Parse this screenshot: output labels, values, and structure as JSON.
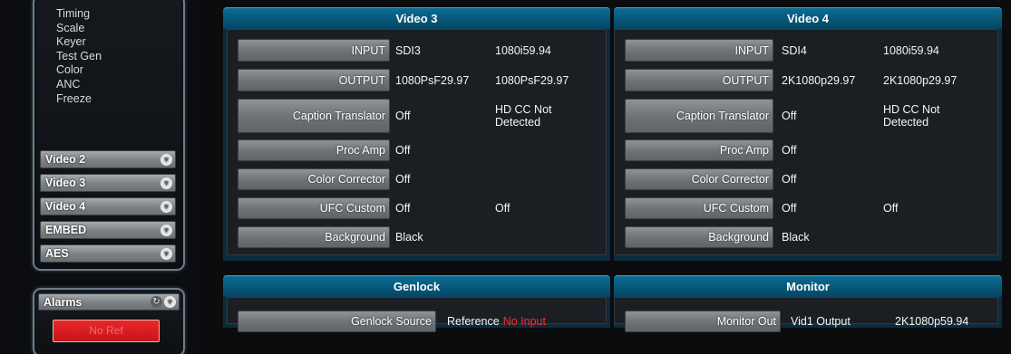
{
  "sidebar": {
    "sub_items": [
      "Timing",
      "Scale",
      "Keyer",
      "Test Gen",
      "Color",
      "ANC",
      "Freeze"
    ],
    "menu_items": [
      {
        "label": "Video 2"
      },
      {
        "label": "Video 3"
      },
      {
        "label": "Video 4"
      },
      {
        "label": "EMBED"
      },
      {
        "label": "AES"
      }
    ],
    "alarms": {
      "label": "Alarms",
      "alarm_button": "No Ref"
    }
  },
  "video3": {
    "title": "Video 3",
    "rows": [
      {
        "button": "INPUT",
        "value1": "SDI3",
        "value2": "1080i59.94"
      },
      {
        "button": "OUTPUT",
        "value1": "1080PsF29.97",
        "value2": "1080PsF29.97"
      },
      {
        "button": "Caption Translator",
        "value1": "Off",
        "value2": "HD CC Not Detected"
      },
      {
        "button": "Proc Amp",
        "value1": "Off",
        "value2": ""
      },
      {
        "button": "Color Corrector",
        "value1": "Off",
        "value2": ""
      },
      {
        "button": "UFC Custom",
        "value1": "Off",
        "value2": "Off"
      },
      {
        "button": "Background",
        "value1": "Black",
        "value2": ""
      }
    ]
  },
  "video4": {
    "title": "Video 4",
    "rows": [
      {
        "button": "INPUT",
        "value1": "SDI4",
        "value2": "1080i59.94"
      },
      {
        "button": "OUTPUT",
        "value1": "2K1080p29.97",
        "value2": "2K1080p29.97"
      },
      {
        "button": "Caption Translator",
        "value1": "Off",
        "value2": "HD CC Not Detected"
      },
      {
        "button": "Proc Amp",
        "value1": "Off",
        "value2": ""
      },
      {
        "button": "Color Corrector",
        "value1": "Off",
        "value2": ""
      },
      {
        "button": "UFC Custom",
        "value1": "Off",
        "value2": "Off"
      },
      {
        "button": "Background",
        "value1": "Black",
        "value2": ""
      }
    ]
  },
  "genlock": {
    "title": "Genlock",
    "button": "Genlock Source",
    "value_label": "Reference",
    "value_status": "No Input"
  },
  "monitor": {
    "title": "Monitor",
    "button": "Monitor Out",
    "value1": "Vid1 Output",
    "value2": "2K1080p59.94"
  },
  "colors": {
    "accent": "#075476",
    "alarm": "#e8272a",
    "status_red": "#ff2a2a"
  }
}
